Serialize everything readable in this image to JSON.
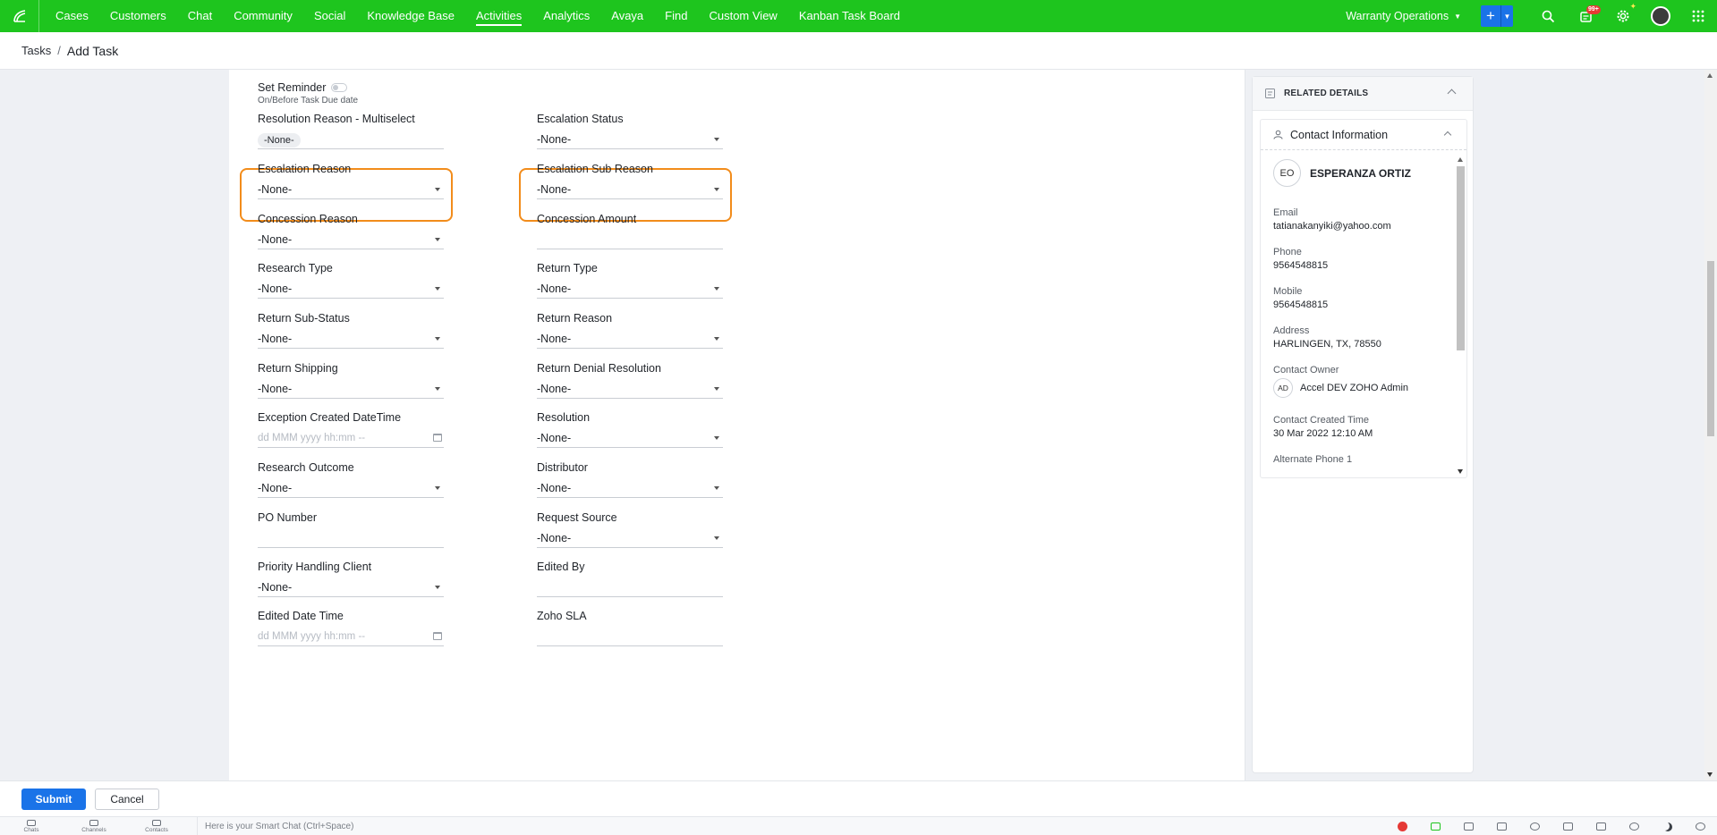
{
  "topnav": {
    "tabs": [
      "Cases",
      "Customers",
      "Chat",
      "Community",
      "Social",
      "Knowledge Base",
      "Activities",
      "Analytics",
      "Avaya",
      "Find",
      "Custom View",
      "Kanban Task Board"
    ],
    "active_tab": "Activities",
    "department": "Warranty Operations",
    "notification_badge": "99+",
    "icons": [
      "logo-icon",
      "plus-icon",
      "search-icon",
      "notification-icon",
      "settings-icon",
      "avatar",
      "apps-grid-icon"
    ],
    "brand_color": "#1ec51e"
  },
  "breadcrumb": {
    "root": "Tasks",
    "separator": "/",
    "current": "Add Task"
  },
  "form": {
    "reminder": {
      "label": "Set Reminder",
      "sublabel": "On/Before Task Due date"
    },
    "fields": [
      {
        "label": "Resolution Reason - Multiselect",
        "value": "-None-",
        "kind": "multi"
      },
      {
        "label": "Escalation Status",
        "value": "-None-",
        "kind": "select"
      },
      {
        "label": "Escalation Reason",
        "value": "-None-",
        "kind": "select",
        "highlighted": true
      },
      {
        "label": "Escalation Sub Reason",
        "value": "-None-",
        "kind": "select",
        "highlighted": true
      },
      {
        "label": "Concession Reason",
        "value": "-None-",
        "kind": "select"
      },
      {
        "label": "Concession Amount",
        "value": "",
        "kind": "text"
      },
      {
        "label": "Research Type",
        "value": "-None-",
        "kind": "select"
      },
      {
        "label": "Return Type",
        "value": "-None-",
        "kind": "select"
      },
      {
        "label": "Return Sub-Status",
        "value": "-None-",
        "kind": "select"
      },
      {
        "label": "Return Reason",
        "value": "-None-",
        "kind": "select"
      },
      {
        "label": "Return Shipping",
        "value": "-None-",
        "kind": "select"
      },
      {
        "label": "Return Denial Resolution",
        "value": "-None-",
        "kind": "select"
      },
      {
        "label": "Exception Created DateTime",
        "placeholder": "dd MMM yyyy hh:mm --",
        "kind": "datetime"
      },
      {
        "label": "Resolution",
        "value": "-None-",
        "kind": "select"
      },
      {
        "label": "Research Outcome",
        "value": "-None-",
        "kind": "select"
      },
      {
        "label": "Distributor",
        "value": "-None-",
        "kind": "select"
      },
      {
        "label": "PO Number",
        "value": "",
        "kind": "text"
      },
      {
        "label": "Request Source",
        "value": "-None-",
        "kind": "select"
      },
      {
        "label": "Priority Handling Client",
        "value": "-None-",
        "kind": "select"
      },
      {
        "label": "Edited By",
        "value": "",
        "kind": "text"
      },
      {
        "label": "Edited Date Time",
        "placeholder": "dd MMM yyyy hh:mm --",
        "kind": "datetime"
      },
      {
        "label": "Zoho SLA",
        "value": "",
        "kind": "text"
      }
    ],
    "highlight_color": "#f28c1b"
  },
  "related": {
    "title": "RELATED DETAILS",
    "contact": {
      "section_title": "Contact Information",
      "initials": "EO",
      "name": "ESPERANZA ORTIZ",
      "email_label": "Email",
      "email": "tatianakanyiki@yahoo.com",
      "phone_label": "Phone",
      "phone": "9564548815",
      "mobile_label": "Mobile",
      "mobile": "9564548815",
      "address_label": "Address",
      "address": "HARLINGEN, TX, 78550",
      "owner_label": "Contact Owner",
      "owner_initials": "AD",
      "owner": "Accel DEV ZOHO Admin",
      "created_label": "Contact Created Time",
      "created": "30 Mar 2022 12:10 AM",
      "alt_phone_label": "Alternate Phone 1"
    }
  },
  "footer": {
    "submit": "Submit",
    "cancel": "Cancel"
  },
  "bottombar": {
    "items": [
      "Chats",
      "Channels",
      "Contacts"
    ],
    "smartchat_placeholder": "Here is your Smart Chat (Ctrl+Space)"
  }
}
